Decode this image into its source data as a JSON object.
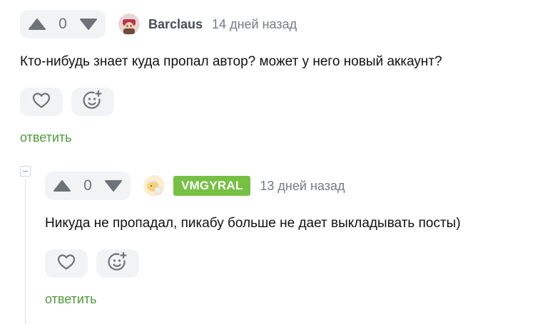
{
  "comments": [
    {
      "rating": "0",
      "username": "Barclaus",
      "time": "14 дней назад",
      "text": "Кто-нибудь знает куда пропал автор? может у него новый аккаунт?",
      "reply_label": "ответить"
    },
    {
      "rating": "0",
      "username": "VMGYRAL",
      "time": "13 дней назад",
      "text": "Никуда не пропадал, пикабу больше не дает выкладывать посты)",
      "reply_label": "ответить"
    }
  ],
  "colors": {
    "accent_green": "#76c043",
    "reply_green": "#4e9a3a",
    "button_bg": "#f2f3f5",
    "icon_gray": "#6e737a"
  },
  "icons": [
    "upvote-icon",
    "downvote-icon",
    "heart-icon",
    "add-reaction-icon",
    "collapse-icon"
  ]
}
